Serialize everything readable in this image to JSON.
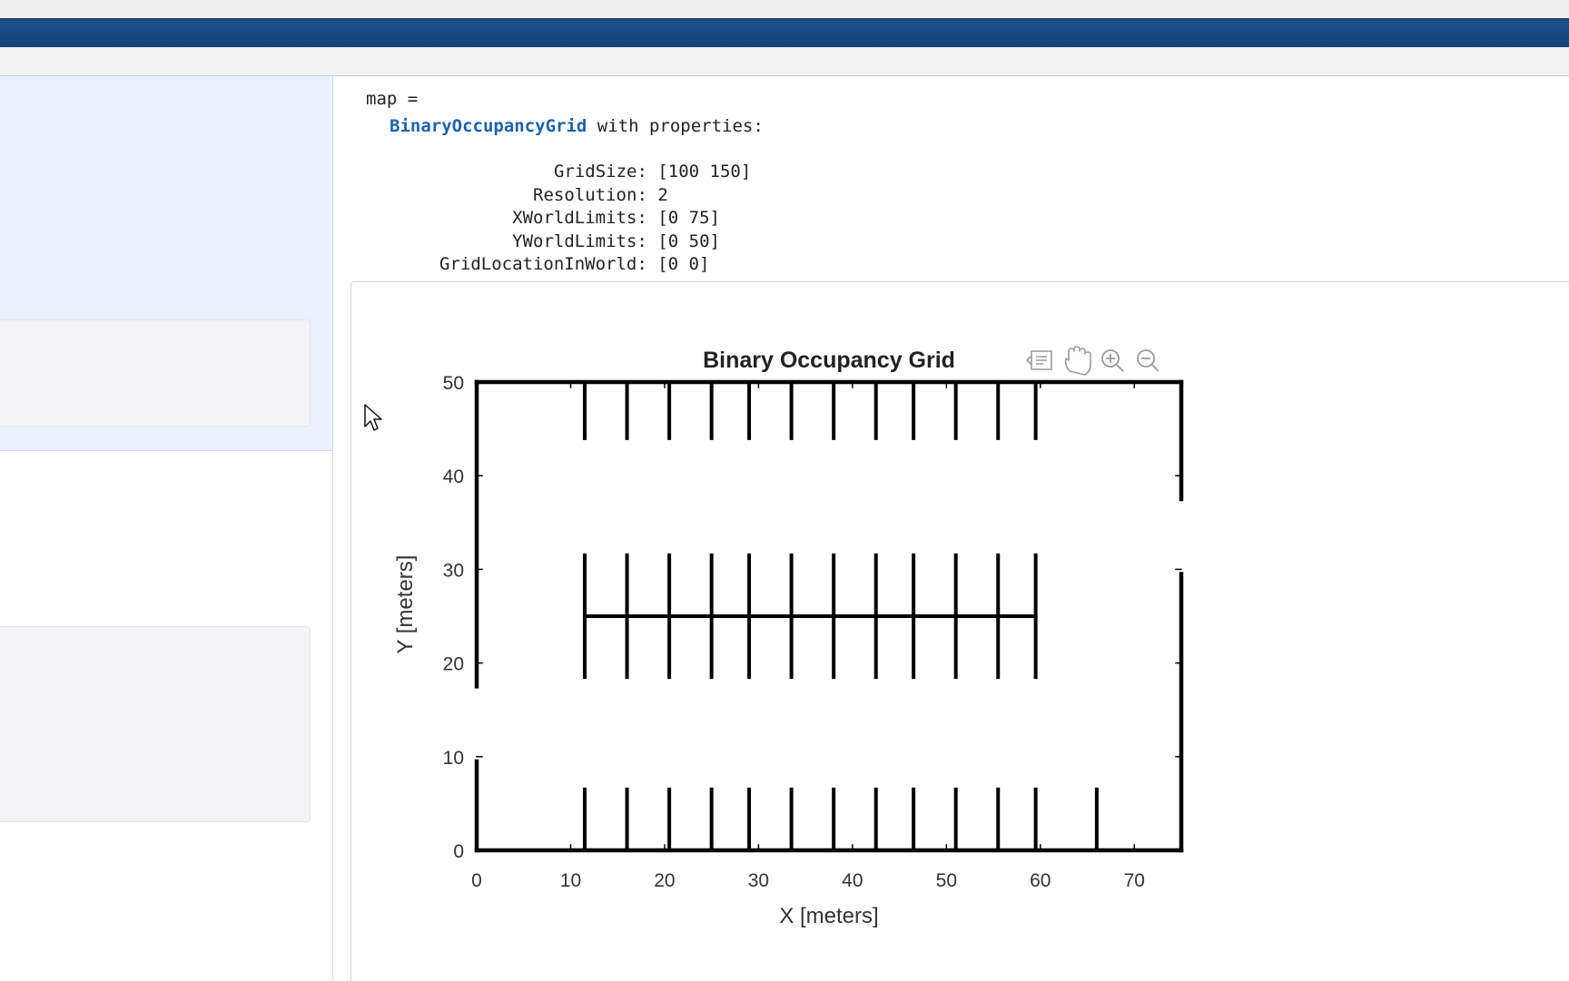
{
  "output": {
    "assign_line": "map =",
    "class_name": "BinaryOccupancyGrid",
    "class_suffix": " with properties:",
    "properties": [
      {
        "name": "GridSize",
        "value": "[100 150]"
      },
      {
        "name": "Resolution",
        "value": "2"
      },
      {
        "name": "XWorldLimits",
        "value": "[0 75]"
      },
      {
        "name": "YWorldLimits",
        "value": "[0 50]"
      },
      {
        "name": "GridLocationInWorld",
        "value": "[0 0]"
      }
    ]
  },
  "axes_toolbar": {
    "icons": [
      "data-tips-icon",
      "pan-hand-icon",
      "zoom-in-icon",
      "zoom-out-icon"
    ]
  },
  "chart_data": {
    "type": "occupancy-grid",
    "title": "Binary Occupancy Grid",
    "xlabel": "X [meters]",
    "ylabel": "Y [meters]",
    "xlim": [
      0,
      75
    ],
    "ylim": [
      0,
      50
    ],
    "xticks": [
      0,
      10,
      20,
      30,
      40,
      50,
      60,
      70
    ],
    "yticks": [
      0,
      10,
      20,
      30,
      40,
      50
    ],
    "grid": false,
    "color": "#000000",
    "boundary": {
      "top": [
        [
          0,
          75
        ]
      ],
      "bottom": [
        [
          0,
          75
        ]
      ],
      "left": [
        [
          0,
          9.5
        ],
        [
          17.5,
          50
        ]
      ],
      "right": [
        [
          0,
          29.5
        ],
        [
          37.5,
          50
        ]
      ]
    },
    "top_row": {
      "x": [
        11.5,
        16,
        20.5,
        25,
        29,
        33.5,
        38,
        42.5,
        46.5,
        51,
        55.5,
        59.5
      ],
      "y": [
        44,
        50
      ]
    },
    "middle_row": {
      "x": [
        11.5,
        16,
        20.5,
        25,
        29,
        33.5,
        38,
        42.5,
        46.5,
        51,
        55.5,
        59.5
      ],
      "y": [
        18.5,
        31.5
      ],
      "spine_y": 25,
      "spine_x": [
        11.5,
        59.5
      ]
    },
    "bottom_row": {
      "x": [
        11.5,
        16,
        20.5,
        25,
        29,
        33.5,
        38,
        42.5,
        46.5,
        51,
        55.5,
        59.5,
        66
      ],
      "y": [
        0,
        6.5
      ]
    }
  }
}
